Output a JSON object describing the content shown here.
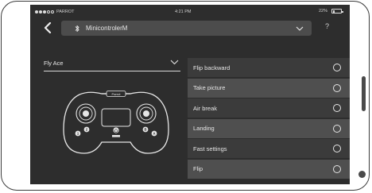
{
  "status_bar": {
    "carrier": "PARROT",
    "time": "4:21 PM",
    "battery_percent": "22%",
    "battery_level": 0.22
  },
  "nav": {
    "back_icon": "chevron-left-icon",
    "device_name": "MinicontrolerM",
    "bluetooth_icon": "bluetooth-icon",
    "help_label": "?"
  },
  "model_select": {
    "value": "Fly Ace"
  },
  "controller": {
    "brand": "Parrot",
    "button_labels": [
      "1",
      "2",
      "B",
      "A"
    ]
  },
  "actions": [
    {
      "label": "Flip backward",
      "selected": false
    },
    {
      "label": "Take picture",
      "selected": false
    },
    {
      "label": "Air break",
      "selected": false
    },
    {
      "label": "Landing",
      "selected": false
    },
    {
      "label": "Fast settings",
      "selected": false
    },
    {
      "label": "Flip",
      "selected": false
    }
  ],
  "colors": {
    "screen_bg": "#2d2d2d",
    "row_dark": "#3b3b3b",
    "row_light": "#4f4f4f",
    "text": "#e6e6e6"
  }
}
